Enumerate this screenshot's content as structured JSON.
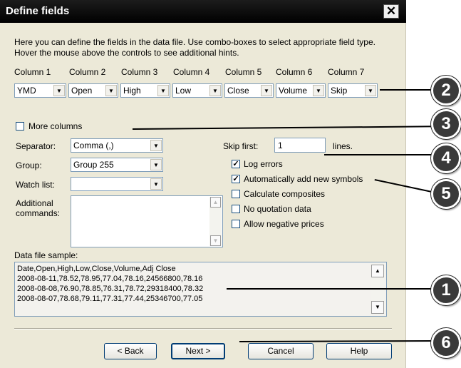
{
  "window": {
    "title": "Define fields",
    "close_glyph": "✕"
  },
  "intro_text": "Here you can define the fields in the data file. Use combo-boxes to select appropriate field type. Hover the mouse above the controls to see additional hints.",
  "columns": [
    {
      "label": "Column 1",
      "value": "YMD"
    },
    {
      "label": "Column 2",
      "value": "Open"
    },
    {
      "label": "Column 3",
      "value": "High"
    },
    {
      "label": "Column 4",
      "value": "Low"
    },
    {
      "label": "Column 5",
      "value": "Close"
    },
    {
      "label": "Column 6",
      "value": "Volume"
    },
    {
      "label": "Column 7",
      "value": "Skip"
    }
  ],
  "more_columns": {
    "label": "More columns",
    "checked": false
  },
  "separator": {
    "label": "Separator:",
    "value": "Comma (,)"
  },
  "group": {
    "label": "Group:",
    "value": "Group 255"
  },
  "watch_list": {
    "label": "Watch list:",
    "value": ""
  },
  "additional_commands": {
    "label_line1": "Additional",
    "label_line2": "commands:",
    "value": ""
  },
  "skip_first": {
    "label": "Skip first:",
    "value": "1",
    "suffix": "lines."
  },
  "options": [
    {
      "label": "Log errors",
      "checked": true
    },
    {
      "label": "Automatically add new symbols",
      "checked": true
    },
    {
      "label": "Calculate composites",
      "checked": false
    },
    {
      "label": "No quotation data",
      "checked": false
    },
    {
      "label": "Allow negative prices",
      "checked": false
    }
  ],
  "sample": {
    "label": "Data file sample:",
    "lines": [
      "Date,Open,High,Low,Close,Volume,Adj Close",
      "2008-08-11,78.52,78.95,77.04,78.16,24566800,78.16",
      "2008-08-08,76.90,78.85,76.31,78.72,29318400,78.32",
      "2008-08-07,78.68,79.11,77.31,77.44,25346700,77.05"
    ]
  },
  "buttons": {
    "back": "< Back",
    "next": "Next >",
    "cancel": "Cancel",
    "help": "Help"
  },
  "callouts": [
    "2",
    "3",
    "4",
    "5",
    "1",
    "6"
  ],
  "glyphs": {
    "dropdown": "▼",
    "scroll_up": "▲",
    "scroll_down": "▼",
    "check": "✓"
  }
}
